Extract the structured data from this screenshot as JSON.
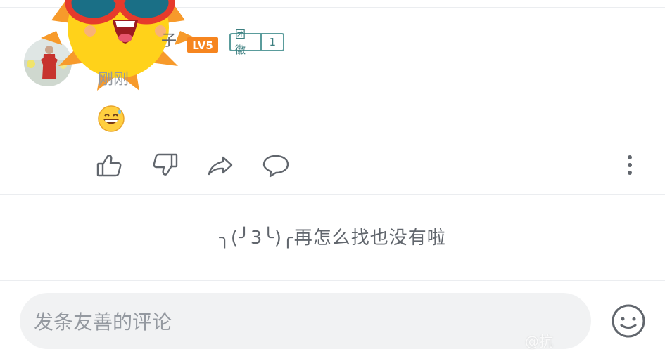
{
  "comment": {
    "username": "子",
    "level": "LV5",
    "medal": {
      "name": "团徽",
      "level": "1"
    },
    "timestamp": "刚刚",
    "content_emoji": "grinning-sweat-emoji"
  },
  "actions": {
    "like": "thumbs-up-icon",
    "dislike": "thumbs-down-icon",
    "share": "share-icon",
    "reply": "reply-bubble-icon",
    "more": "more-vertical-icon"
  },
  "end_message": "╮(╯3╰)╭再怎么找也没有啦",
  "composer": {
    "placeholder": "发条友善的评论"
  },
  "watermark": "@抗",
  "colors": {
    "level_badge": "#f6851f",
    "medal": "#5a9c9c",
    "icon": "#61666d"
  }
}
